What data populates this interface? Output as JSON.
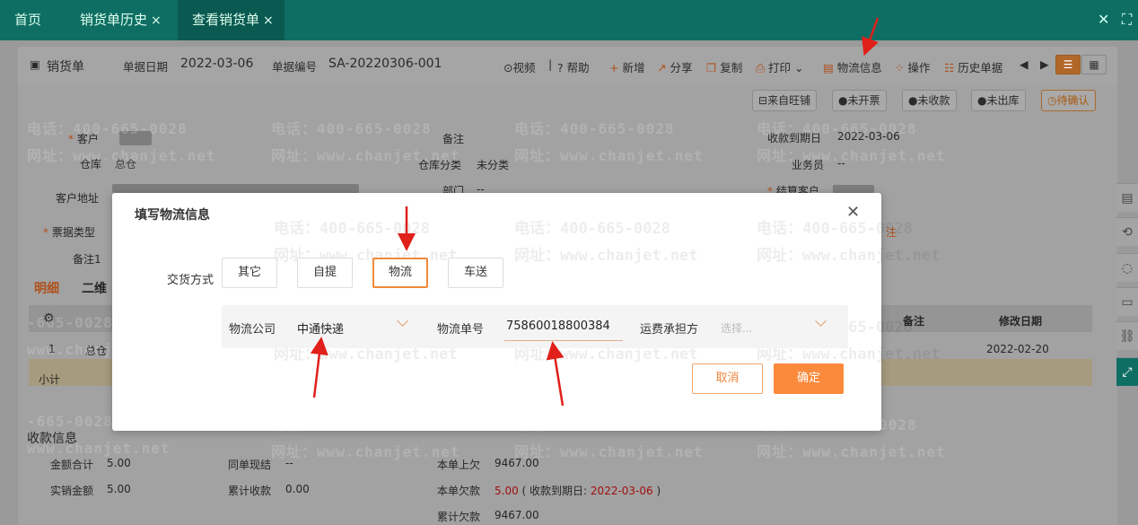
{
  "tabs": [
    {
      "label": "首页",
      "closable": false,
      "active": false
    },
    {
      "label": "销货单历史",
      "closable": true,
      "active": false
    },
    {
      "label": "查看销货单",
      "closable": true,
      "active": true
    }
  ],
  "window_controls": {
    "close": "✕",
    "maximize": "⛶"
  },
  "doc_header": {
    "title": "销货单",
    "date_label": "单据日期",
    "date": "2022-03-06",
    "no_label": "单据编号",
    "no": "SA-20220306-001"
  },
  "toolbar": {
    "video": "视频",
    "help": "帮助",
    "new": "新增",
    "share": "分享",
    "copy": "复制",
    "print": "打印",
    "logistics": "物流信息",
    "operate": "操作",
    "history": "历史单据"
  },
  "status_pills": {
    "source": "来自旺铺",
    "invoice": "未开票",
    "receipt": "未收款",
    "outbound": "未出库",
    "confirm": "待确认"
  },
  "form_bg": {
    "customer_label": "客户",
    "warehouse_label": "仓库",
    "warehouse_value": "总仓",
    "address_label": "客户地址",
    "ticket_type_label": "票据类型",
    "remark1_label": "备注1",
    "remark_label": "备注",
    "warehouse_cat_label": "仓库分类",
    "warehouse_cat_value": "未分类",
    "dept_label": "部门",
    "dept_value": "--",
    "due_label": "收款到期日",
    "due_value": "2022-03-06",
    "sales_label": "业务员",
    "sales_value": "--",
    "settle_label": "结算客户",
    "tail_label": "注"
  },
  "detail_tabs": {
    "detail": "明细",
    "qr": "二维"
  },
  "table": {
    "row1_no": "1",
    "row1_wh": "总仓",
    "subtotal": "小计",
    "remark_col": "备注",
    "modified_col": "修改日期",
    "row1_modified": "2022-02-20"
  },
  "payment": {
    "section_title": "收款信息",
    "total_label": "金额合计",
    "total_value": "5.00",
    "actual_label": "实销金额",
    "actual_value": "5.00",
    "cash_label": "同单现结",
    "cash_value": "--",
    "cum_recv_label": "累计收款",
    "cum_recv_value": "0.00",
    "prev_owe_label": "本单上欠",
    "prev_owe_value": "9467.00",
    "this_owe_label": "本单欠款",
    "this_owe_value": "5.00",
    "this_owe_note_pre": "( 收款到期日:",
    "this_owe_note_date": "2022-03-06",
    "this_owe_note_post": ")",
    "cum_owe_label": "累计欠款",
    "cum_owe_value": "9467.00"
  },
  "watermark": {
    "phone": "电话：400-665-0028",
    "phone_short": "-665-0028",
    "site": "网址：www.chanjet.net",
    "site_short": "www.chanjet.net"
  },
  "modal": {
    "title": "填写物流信息",
    "delivery_label": "交货方式",
    "options": [
      "其它",
      "自提",
      "物流",
      "车送"
    ],
    "selected_option": "物流",
    "company_label": "物流公司",
    "company_value": "中通快递",
    "tracking_label": "物流单号",
    "tracking_value": "75860018800384",
    "freight_label": "运费承担方",
    "freight_placeholder": "选择...",
    "cancel": "取消",
    "ok": "确定"
  },
  "colors": {
    "accent": "#fb8a3c",
    "tabbar": "#0f6e64",
    "arrow": "#e0201a"
  }
}
